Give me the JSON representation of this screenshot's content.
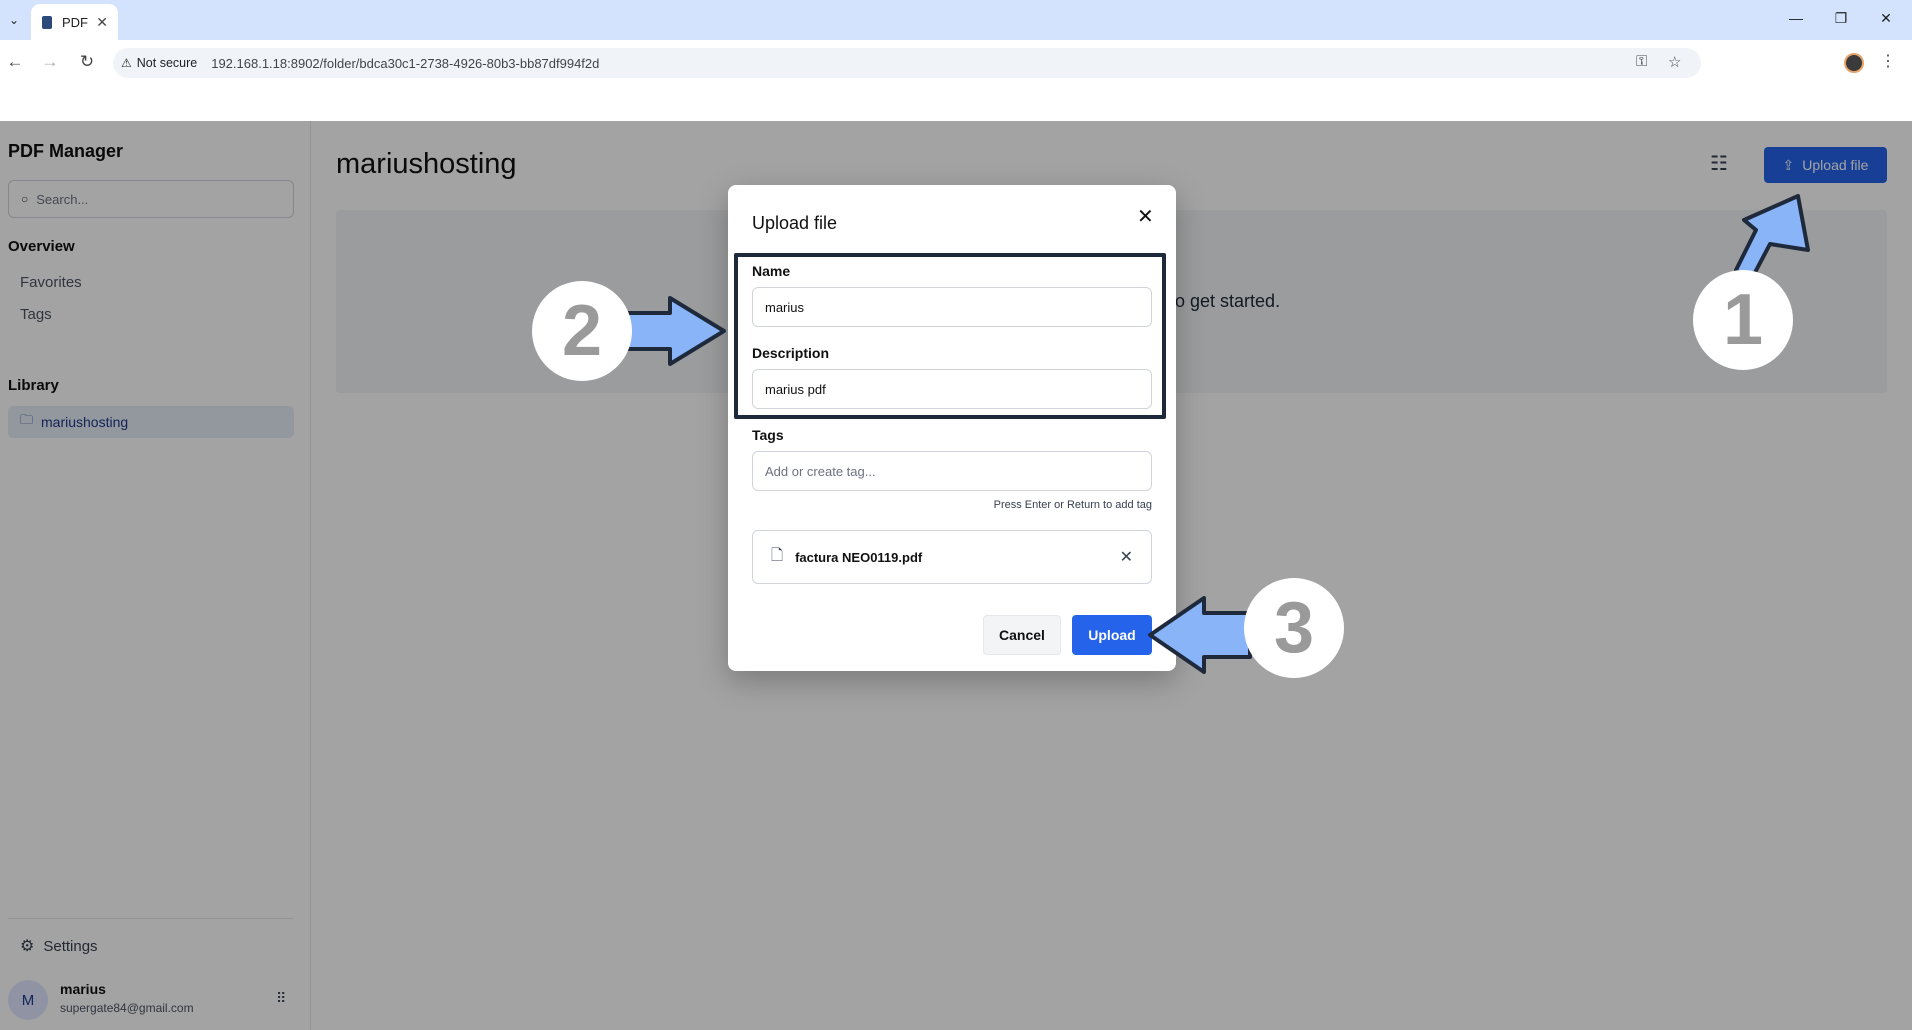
{
  "browser": {
    "tab_title": "PDF",
    "security_label": "Not secure",
    "url": "192.168.1.18:8902/folder/bdca30c1-2738-4926-80b3-bb87df994f2d"
  },
  "sidebar": {
    "brand": "PDF Manager",
    "search_placeholder": "Search...",
    "overview_heading": "Overview",
    "nav": [
      "Favorites",
      "Tags"
    ],
    "library_heading": "Library",
    "folder": "mariushosting",
    "settings": "Settings",
    "user": {
      "initial": "M",
      "name": "marius",
      "email": "supergate84@gmail.com"
    }
  },
  "main": {
    "title": "mariushosting",
    "upload_button": "Upload file",
    "empty_text_visible": "o get started."
  },
  "modal": {
    "title": "Upload file",
    "name_label": "Name",
    "name_value": "marius",
    "description_label": "Description",
    "description_value": "marius pdf",
    "tags_label": "Tags",
    "tags_placeholder": "Add or create tag...",
    "tags_hint": "Press Enter or Return to add tag",
    "file_name": "factura NEO0119.pdf",
    "cancel": "Cancel",
    "upload": "Upload"
  },
  "annotations": {
    "steps": [
      "1",
      "2",
      "3"
    ]
  },
  "colors": {
    "primary": "#2563eb",
    "arrow_fill": "#8ab4f8",
    "tabstrip": "#d3e3fd"
  }
}
